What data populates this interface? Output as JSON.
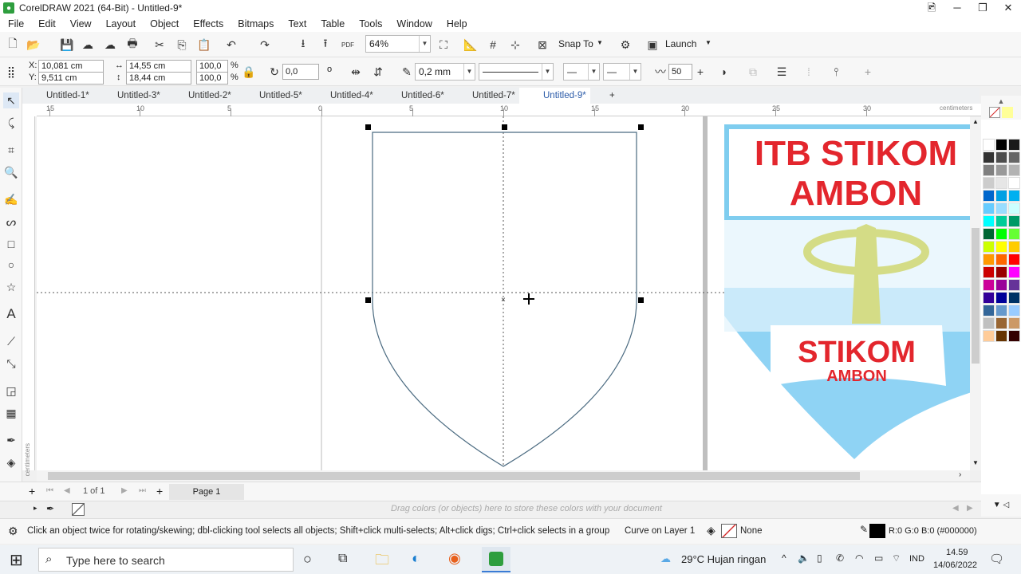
{
  "window": {
    "title": "CorelDRAW 2021 (64-Bit) - Untitled-9*",
    "app_icon": "coreldraw-icon"
  },
  "menu": [
    "File",
    "Edit",
    "View",
    "Layout",
    "Object",
    "Effects",
    "Bitmaps",
    "Text",
    "Table",
    "Tools",
    "Window",
    "Help"
  ],
  "toolbar1": {
    "zoom": "64%",
    "snap_label": "Snap To",
    "launch_label": "Launch"
  },
  "toolbar2": {
    "x_label": "X:",
    "x_value": "10,081 cm",
    "y_label": "Y:",
    "y_value": "9,511 cm",
    "w_value": "14,55 cm",
    "h_value": "18,44 cm",
    "scale_x": "100,0",
    "scale_y": "100,0",
    "pct": "%",
    "rotation": "0,0",
    "rotation_unit": "o",
    "outline_width": "0,2 mm",
    "smoothing": "50"
  },
  "tabs": [
    "Untitled-1*",
    "Untitled-3*",
    "Untitled-2*",
    "Untitled-5*",
    "Untitled-4*",
    "Untitled-6*",
    "Untitled-7*",
    "Untitled-9*"
  ],
  "active_tab": "Untitled-9*",
  "ruler": {
    "labels": [
      "15",
      "10",
      "5",
      "0",
      "5",
      "10",
      "15",
      "20",
      "25",
      "30"
    ],
    "unit": "centimeters",
    "v_unit": "centimeters"
  },
  "logo": {
    "line1": "ITB STIKOM",
    "line2": "AMBON",
    "banner1": "STIKOM",
    "banner2": "AMBON",
    "colors": {
      "red": "#e3262d",
      "blue": "#6ec6ee",
      "olive": "#d4dc86"
    }
  },
  "pagebar": {
    "page_info": "1 of 1",
    "page_tab": "Page 1"
  },
  "doc_palette_hint": "Drag colors (or objects) here to store these colors with your document",
  "status": {
    "hint": "Click an object twice for rotating/skewing; dbl-clicking tool selects all objects; Shift+click multi-selects; Alt+click digs; Ctrl+click selects in a group",
    "layer": "Curve on Layer 1",
    "fill": "None",
    "outline_color": "R:0 G:0 B:0 (#000000)"
  },
  "taskbar": {
    "search_placeholder": "Type here to search",
    "weather": "29°C  Hujan ringan",
    "lang": "IND",
    "time": "14.59",
    "date": "14/06/2022"
  },
  "palette_colors": [
    "#ffffff",
    "#000000",
    "#1a1a1a",
    "#333333",
    "#4d4d4d",
    "#666666",
    "#808080",
    "#999999",
    "#b3b3b3",
    "#cccccc",
    "#e6e6e6",
    "#ffffff",
    "#0066cc",
    "#00a0e3",
    "#00b0f0",
    "#66ccff",
    "#99ddff",
    "#ccffff",
    "#00ffff",
    "#00cc99",
    "#009966",
    "#006633",
    "#00ff00",
    "#66ff33",
    "#ccff00",
    "#ffff00",
    "#ffcc00",
    "#ff9900",
    "#ff6600",
    "#ff0000",
    "#cc0000",
    "#990000",
    "#ff00ff",
    "#cc0099",
    "#990099",
    "#663399",
    "#330099",
    "#000099",
    "#003366",
    "#336699",
    "#6699cc",
    "#99ccff",
    "#c0c0c0",
    "#996633",
    "#cc9966",
    "#ffcc99",
    "#663300",
    "#330000"
  ]
}
